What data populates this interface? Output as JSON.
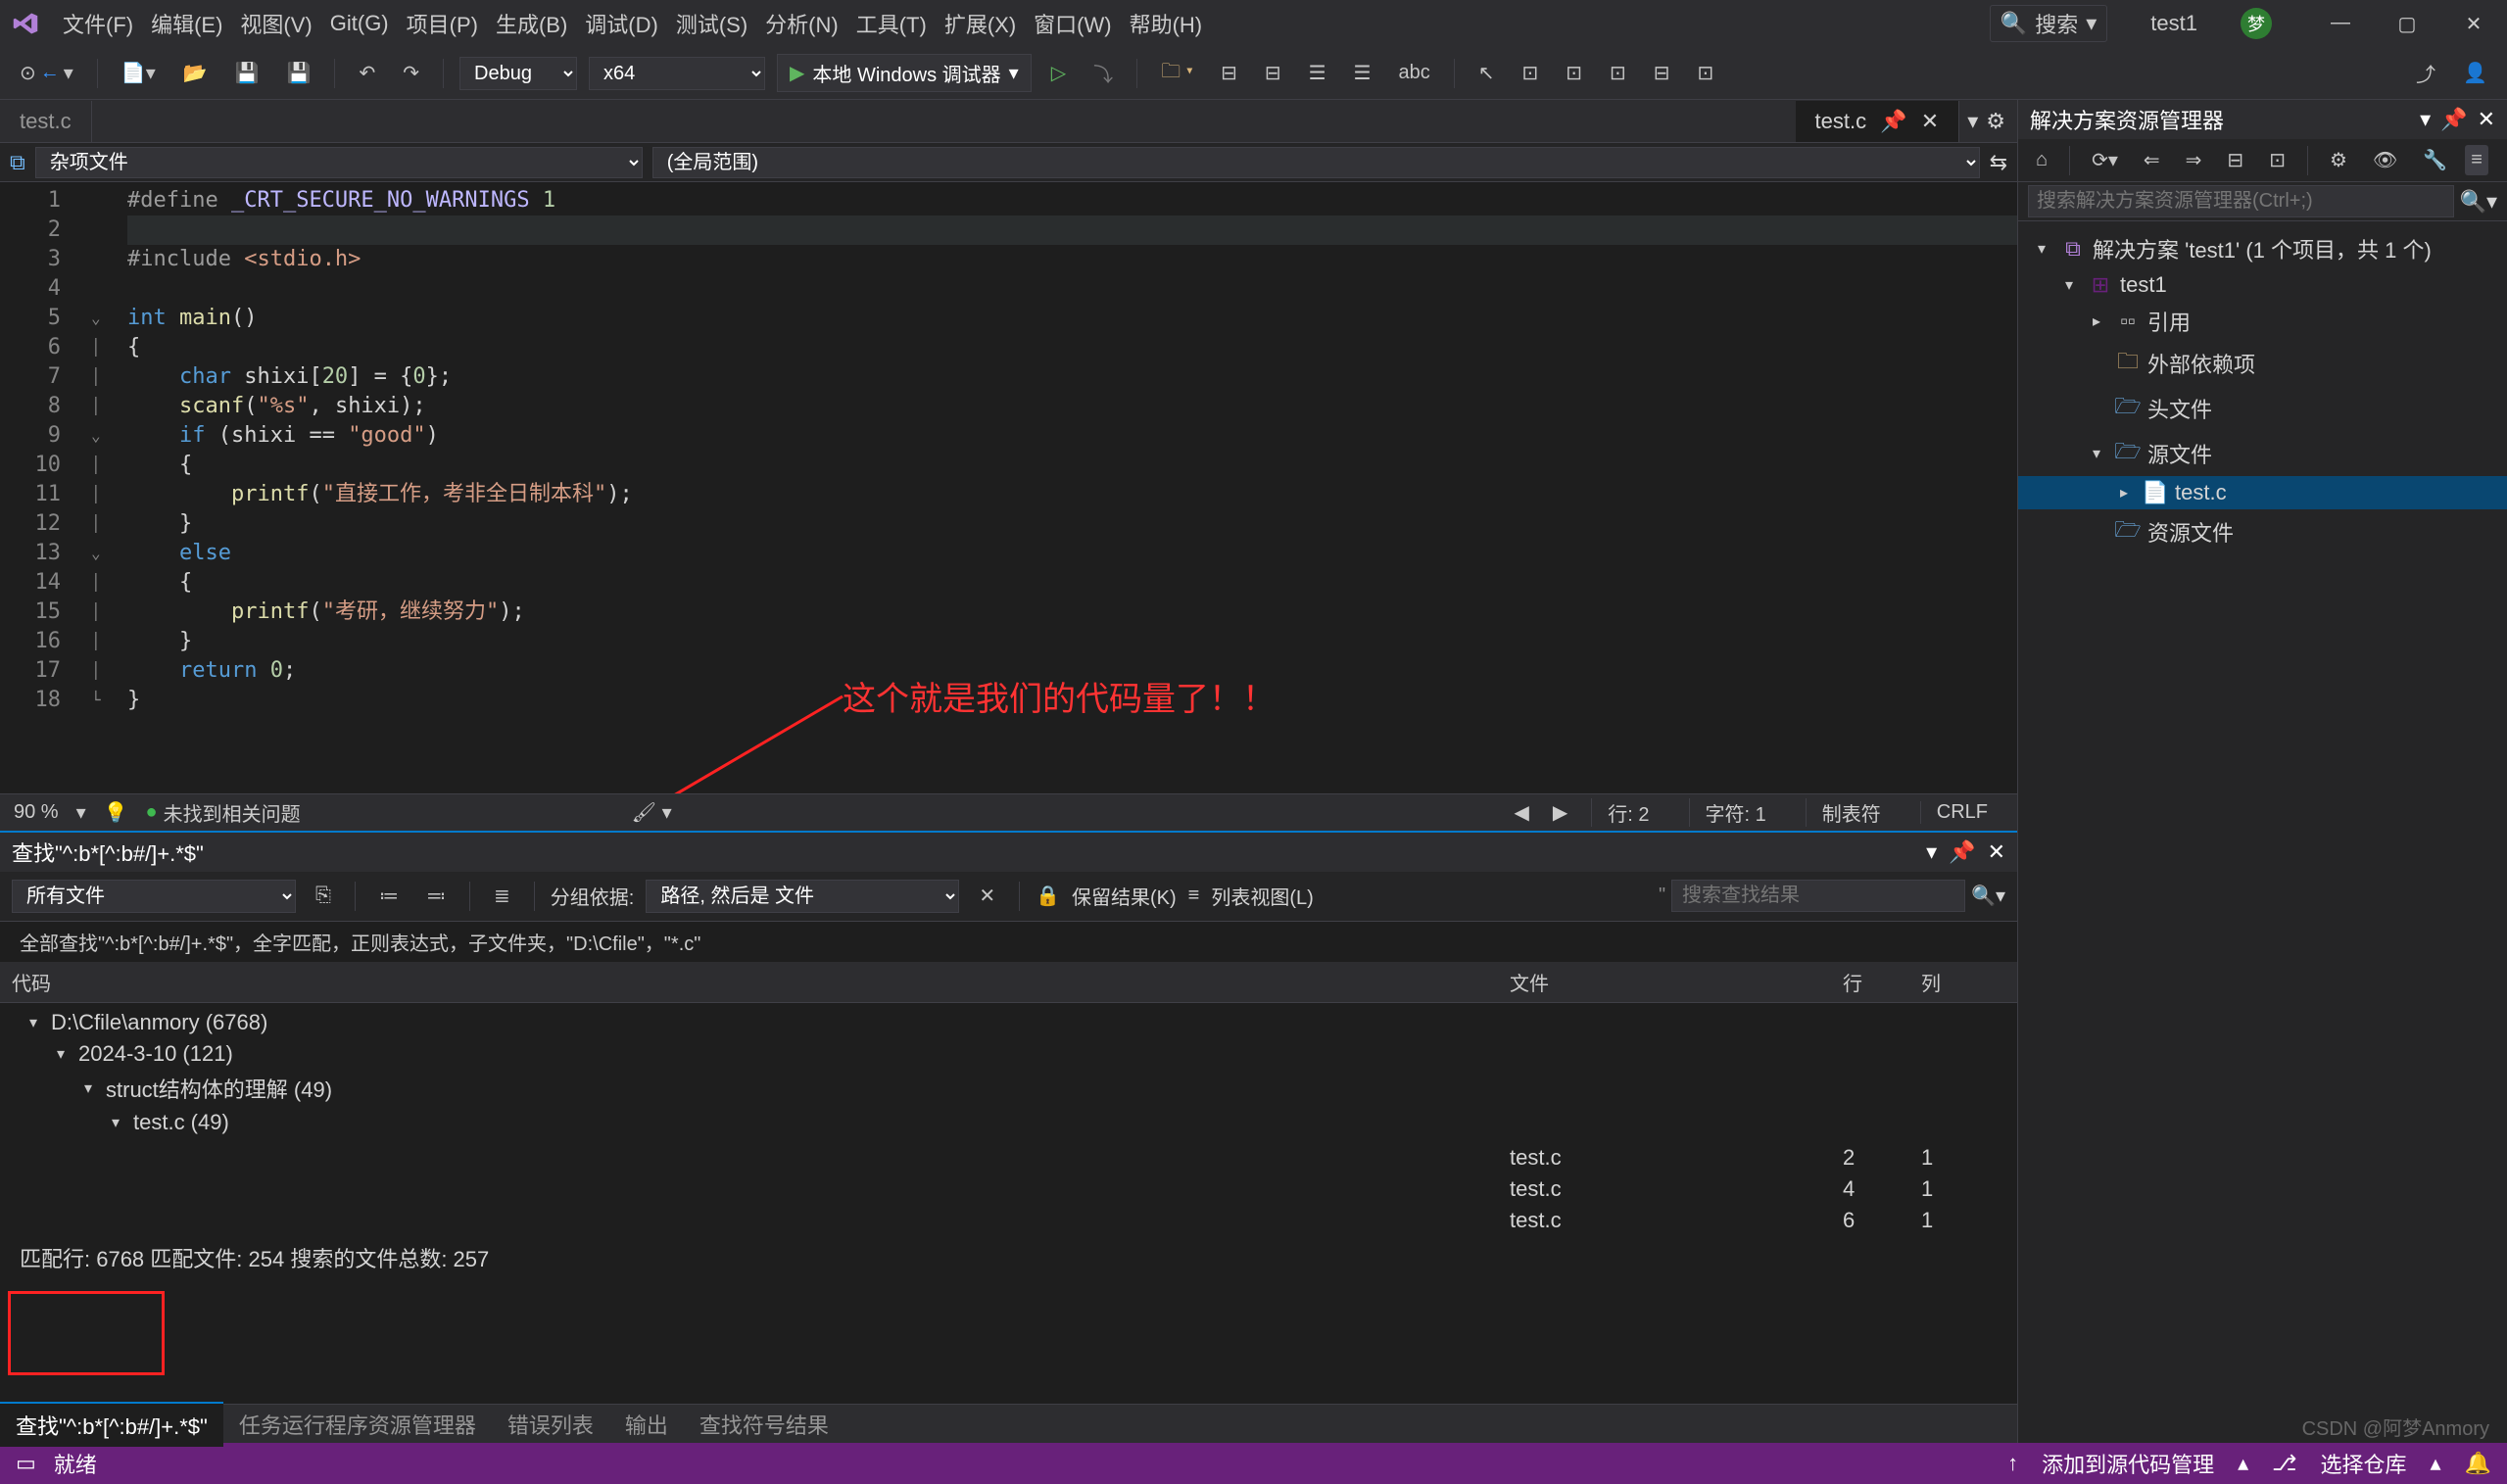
{
  "title_bar": {
    "menus": [
      "文件(F)",
      "编辑(E)",
      "视图(V)",
      "Git(G)",
      "项目(P)",
      "生成(B)",
      "调试(D)",
      "测试(S)",
      "分析(N)",
      "工具(T)",
      "扩展(X)",
      "窗口(W)",
      "帮助(H)"
    ],
    "search_label": "搜索",
    "project": "test1",
    "avatar_initial": "梦"
  },
  "toolbar": {
    "config": "Debug",
    "platform": "x64",
    "debugger_label": "本地 Windows 调试器"
  },
  "editor": {
    "tab_inactive": "test.c",
    "tab_active": "test.c",
    "nav_left": "杂项文件",
    "nav_right": "(全局范围)",
    "lines": [
      {
        "n": "1",
        "html": "<span class='k-pre'>#define</span> <span class='k-macro'>_CRT_SECURE_NO_WARNINGS</span> <span class='k-num'>1</span>"
      },
      {
        "n": "2",
        "html": "<span class='highlight-line'> </span>"
      },
      {
        "n": "3",
        "html": "<span class='k-pre'>#include</span> <span class='k-inc'>&lt;stdio.h&gt;</span>"
      },
      {
        "n": "4",
        "html": ""
      },
      {
        "n": "5",
        "html": "<span class='k-kw'>int</span> <span class='k-fn'>main</span><span class='k-sym'>()</span>"
      },
      {
        "n": "6",
        "html": "<span class='k-sym'>{</span>"
      },
      {
        "n": "7",
        "html": "    <span class='k-kw'>char</span> shixi[<span class='k-num'>20</span>] = {<span class='k-num'>0</span>};"
      },
      {
        "n": "8",
        "html": "    <span class='k-fn'>scanf</span>(<span class='k-str'>\"%s\"</span>, shixi);"
      },
      {
        "n": "9",
        "html": "    <span class='k-kw'>if</span> (shixi == <span class='k-str'>\"good\"</span>)"
      },
      {
        "n": "10",
        "html": "    {"
      },
      {
        "n": "11",
        "html": "        <span class='k-fn'>printf</span>(<span class='k-str'>\"直接工作，考非全日制本科\"</span>);"
      },
      {
        "n": "12",
        "html": "    }"
      },
      {
        "n": "13",
        "html": "    <span class='k-kw'>else</span>"
      },
      {
        "n": "14",
        "html": "    {"
      },
      {
        "n": "15",
        "html": "        <span class='k-fn'>printf</span>(<span class='k-str'>\"考研，继续努力\"</span>);"
      },
      {
        "n": "16",
        "html": "    }"
      },
      {
        "n": "17",
        "html": "    <span class='k-kw'>return</span> <span class='k-num'>0</span>;"
      },
      {
        "n": "18",
        "html": "<span class='k-sym'>}</span>"
      }
    ],
    "status": {
      "zoom": "90 %",
      "issues": "未找到相关问题",
      "line": "行: 2",
      "col": "字符: 1",
      "tabs": "制表符",
      "eol": "CRLF"
    }
  },
  "annotation": {
    "text": "这个就是我们的代码量了！！"
  },
  "find": {
    "title": "查找\"^:b*[^:b#/]+.*$\"",
    "filter": "所有文件",
    "group_label": "分组依据:",
    "group_value": "路径, 然后是 文件",
    "keep_label": "保留结果(K)",
    "list_view": "列表视图(L)",
    "search_placeholder": "搜索查找结果",
    "summary": "全部查找\"^:b*[^:b#/]+.*$\"，全字匹配，正则表达式，子文件夹，\"D:\\Cfile\"，\"*.c\"",
    "cols": {
      "code": "代码",
      "file": "文件",
      "line": "行",
      "col": "列"
    },
    "tree": [
      {
        "level": 1,
        "exp": "▾",
        "label": "D:\\Cfile\\anmory (6768)"
      },
      {
        "level": 2,
        "exp": "▾",
        "label": "2024-3-10 (121)"
      },
      {
        "level": 3,
        "exp": "▾",
        "label": "struct结构体的理解 (49)"
      },
      {
        "level": 4,
        "exp": "▾",
        "label": "test.c (49)"
      }
    ],
    "rows": [
      {
        "code": "",
        "file": "test.c",
        "line": "2",
        "col": "1"
      },
      {
        "code": "",
        "file": "test.c",
        "line": "4",
        "col": "1"
      },
      {
        "code": "",
        "file": "test.c",
        "line": "6",
        "col": "1"
      }
    ],
    "stats": "匹配行: 6768 匹配文件: 254 搜索的文件总数: 257"
  },
  "bottom_tabs": {
    "active": "查找\"^:b*[^:b#/]+.*$\"",
    "others": [
      "任务运行程序资源管理器",
      "错误列表",
      "输出",
      "查找符号结果"
    ]
  },
  "solution_explorer": {
    "title": "解决方案资源管理器",
    "search_placeholder": "搜索解决方案资源管理器(Ctrl+;)",
    "root": "解决方案 'test1' (1 个项目，共 1 个)",
    "nodes": [
      {
        "level": 1,
        "exp": "▾",
        "icon": "i-sol",
        "label_key": "solution_explorer.root"
      },
      {
        "level": 2,
        "exp": "▾",
        "icon": "i-proj",
        "label": "test1"
      },
      {
        "level": 3,
        "exp": "▸",
        "icon": "i-ref",
        "label": "引用"
      },
      {
        "level": 3,
        "exp": " ",
        "icon": "i-folder",
        "label": "外部依赖项"
      },
      {
        "level": 3,
        "exp": " ",
        "icon": "i-filter",
        "label": "头文件"
      },
      {
        "level": 3,
        "exp": "▾",
        "icon": "i-filter",
        "label": "源文件"
      },
      {
        "level": 4,
        "exp": "▸",
        "icon": "i-cfile",
        "label": "test.c",
        "selected": true
      },
      {
        "level": 3,
        "exp": " ",
        "icon": "i-filter",
        "label": "资源文件"
      }
    ]
  },
  "status_bar": {
    "ready": "就绪",
    "scm": "添加到源代码管理",
    "repo": "选择仓库"
  },
  "watermark": "CSDN @阿梦Anmory"
}
